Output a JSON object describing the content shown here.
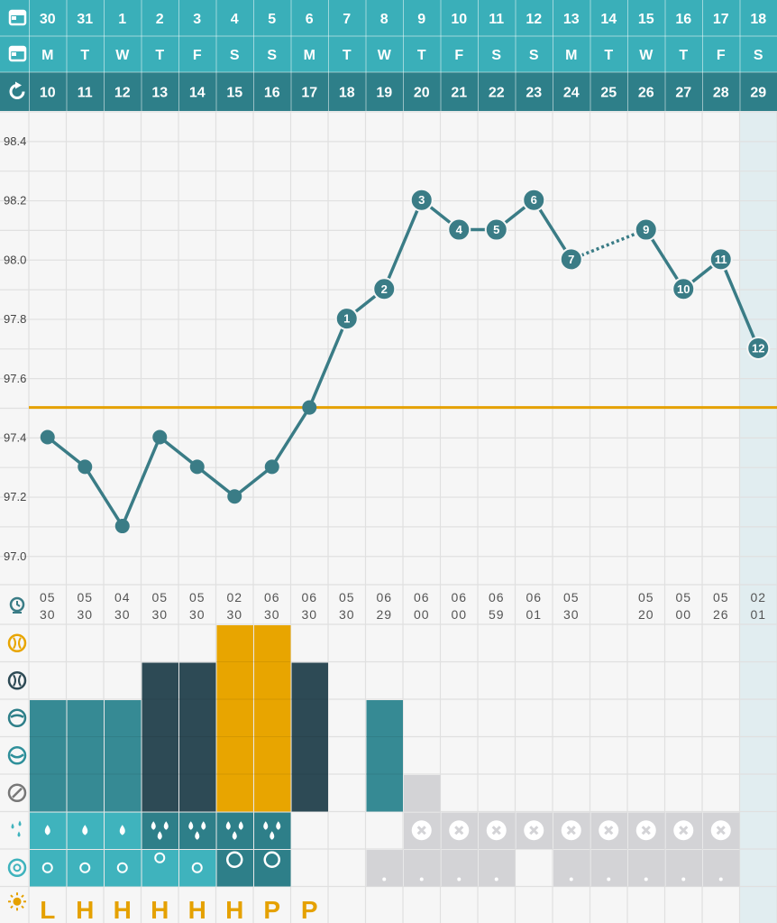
{
  "colors": {
    "header_light": "#3aafb9",
    "header_dark": "#2e7f89",
    "line": "#3a7c86",
    "coverline": "#e5a100",
    "mucus_dark": "#2d4a55",
    "mucus_teal": "#368a94",
    "mucus_yellow": "#e8a500",
    "flow_light": "#3fb3bd",
    "flow_dark": "#2e7f89",
    "empty_gray": "#d3d3d6"
  },
  "icons": {
    "header_row1": "calendar-icon",
    "header_row2": "calendar-icon",
    "header_row3": "cycle-icon",
    "time_row": "clock-icon",
    "mucus_eggwhite": "eggwhite-icon",
    "mucus_watery": "watery-icon",
    "mucus_creamy": "creamy-icon",
    "mucus_sticky": "sticky-icon",
    "mucus_dry": "dry-icon",
    "flow_row": "drops-icon",
    "cervix_row": "cervix-icon",
    "opk_row": "sun-icon"
  },
  "header": {
    "dates": [
      "30",
      "31",
      "1",
      "2",
      "3",
      "4",
      "5",
      "6",
      "7",
      "8",
      "9",
      "10",
      "11",
      "12",
      "13",
      "14",
      "15",
      "16",
      "17",
      "18"
    ],
    "weekdays": [
      "M",
      "T",
      "W",
      "T",
      "F",
      "S",
      "S",
      "M",
      "T",
      "W",
      "T",
      "F",
      "S",
      "S",
      "M",
      "T",
      "W",
      "T",
      "F",
      "S"
    ],
    "cycle_days": [
      "10",
      "11",
      "12",
      "13",
      "14",
      "15",
      "16",
      "17",
      "18",
      "19",
      "20",
      "21",
      "22",
      "23",
      "24",
      "25",
      "26",
      "27",
      "28",
      "29"
    ]
  },
  "chart_data": {
    "type": "line",
    "ylim": [
      96.9,
      98.5
    ],
    "yticks": [
      "98.4",
      "98.2",
      "98.0",
      "97.8",
      "97.6",
      "97.4",
      "97.2",
      "97.0"
    ],
    "coverline": 97.5,
    "temps": [
      97.4,
      97.3,
      97.1,
      97.4,
      97.3,
      97.2,
      97.3,
      97.5,
      97.8,
      97.9,
      98.2,
      98.1,
      98.1,
      98.2,
      98.0,
      null,
      98.1,
      97.9,
      98.0,
      97.7
    ],
    "point_labels": [
      "",
      "",
      "",
      "",
      "",
      "",
      "",
      "",
      "1",
      "2",
      "3",
      "4",
      "5",
      "6",
      "7",
      "",
      "9",
      "10",
      "11",
      "12"
    ],
    "dotted_segment": [
      14,
      16
    ]
  },
  "times": {
    "top": [
      "05",
      "05",
      "04",
      "05",
      "05",
      "02",
      "06",
      "06",
      "05",
      "06",
      "06",
      "06",
      "06",
      "06",
      "05",
      "",
      "05",
      "05",
      "05",
      "02"
    ],
    "bottom": [
      "30",
      "30",
      "30",
      "30",
      "30",
      "30",
      "30",
      "30",
      "30",
      "29",
      "00",
      "00",
      "59",
      "01",
      "30",
      "",
      "20",
      "00",
      "26",
      "01"
    ]
  },
  "mucus": [
    "creamy",
    "creamy",
    "creamy",
    "watery",
    "watery",
    "eggwhite",
    "eggwhite",
    "watery",
    "none",
    "creamy",
    "dry",
    "none",
    "none",
    "none",
    "none",
    "none",
    "none",
    "none",
    "none",
    "none"
  ],
  "flow": [
    "1",
    "1",
    "1",
    "3",
    "3",
    "3",
    "3",
    "none",
    "none",
    "none",
    "x",
    "x",
    "x",
    "x",
    "x",
    "x",
    "x",
    "x",
    "x",
    "none"
  ],
  "cervix": [
    "o",
    "o",
    "o",
    "O",
    "o",
    "OO",
    "OO",
    "none",
    "none",
    "dot",
    "dot",
    "dot",
    "dot",
    "none",
    "dot",
    "dot",
    "dot",
    "dot",
    "dot",
    "none"
  ],
  "opk": [
    "L",
    "H",
    "H",
    "H",
    "H",
    "H",
    "P",
    "P",
    "",
    "",
    "",
    "",
    "",
    "",
    "",
    "",
    "",
    "",
    "",
    ""
  ]
}
